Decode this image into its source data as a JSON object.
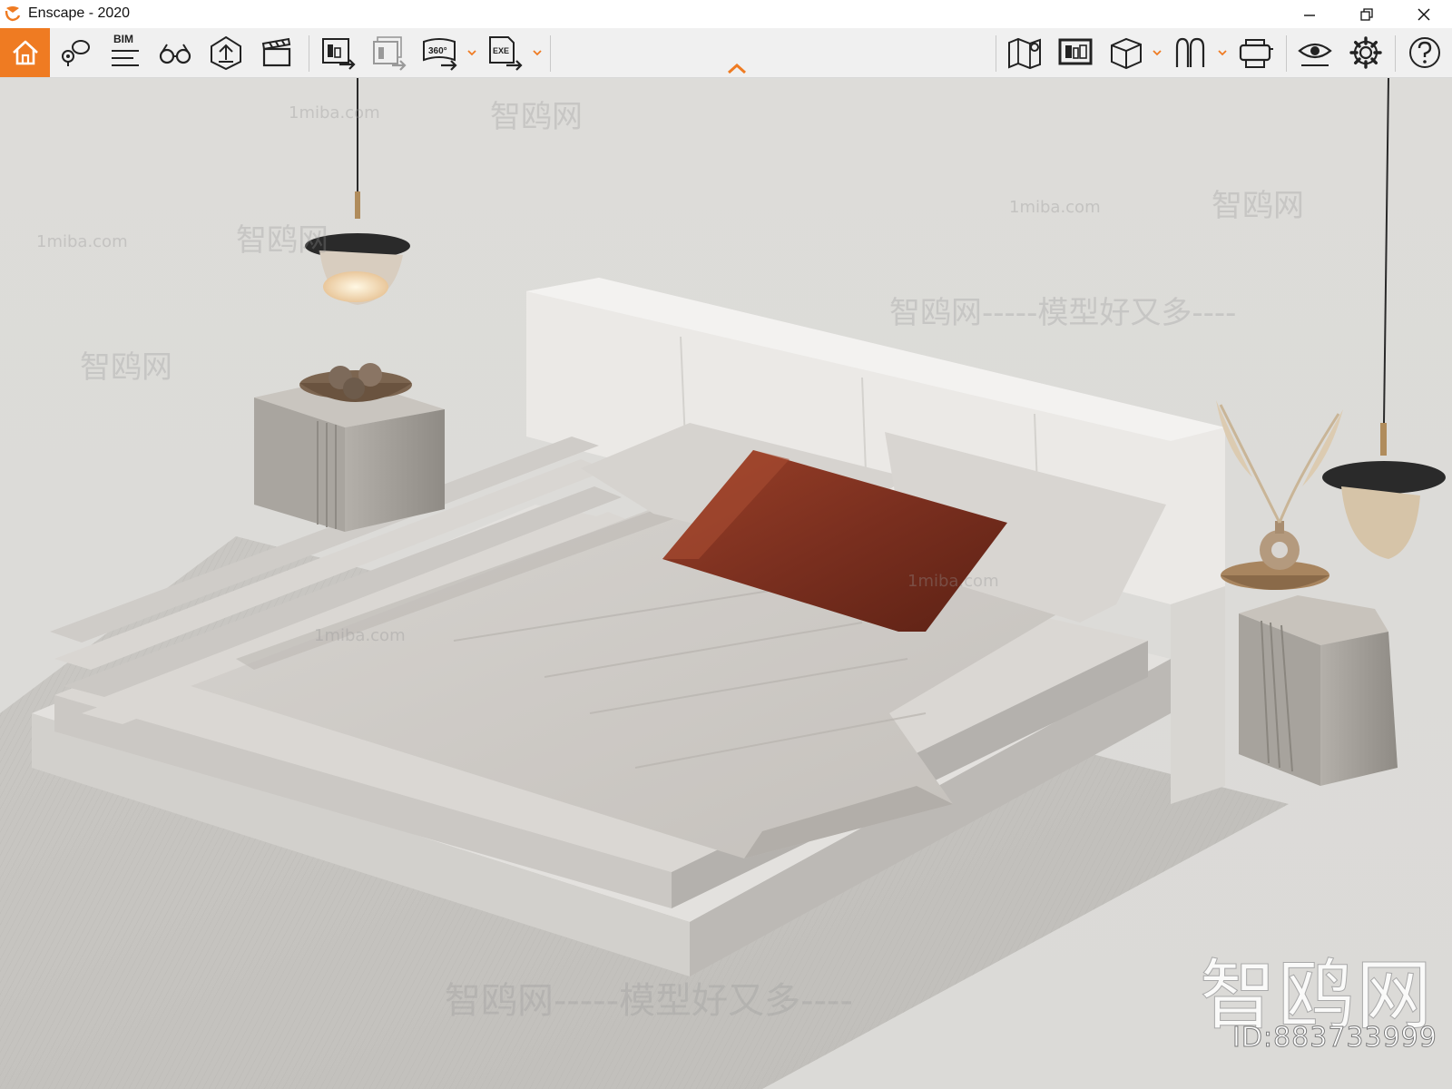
{
  "window": {
    "title": "Enscape - 2020",
    "accent": "#ef7b22"
  },
  "toolbar": {
    "bim_label": "BIM",
    "pano_label": "360°",
    "exe_label": "EXE",
    "left_icons": [
      "home-icon",
      "views-icon",
      "bim-icon",
      "binoculars-icon",
      "upload-icon",
      "video-clapper-icon",
      "export-screenshot-icon",
      "batch-render-icon",
      "panorama-icon",
      "exe-export-icon"
    ],
    "right_icons": [
      "map-icon",
      "asset-library-icon",
      "cube-icon",
      "walk-mode-icon",
      "vr-headset-icon",
      "visual-settings-icon",
      "settings-gear-icon",
      "help-icon"
    ]
  },
  "scene": {
    "watermarks": {
      "site": "1miba.com",
      "cn_brand": "智鸥网",
      "cn_slogan": "智鸥网-----模型好又多----",
      "id_label": "ID:883733999"
    },
    "colors": {
      "background": "#dcdbd8",
      "headboard": "#ececea",
      "sheet": "#cfccc7",
      "pillow_accent": "#7a2f1f",
      "rug": "#c9c7c3"
    }
  }
}
